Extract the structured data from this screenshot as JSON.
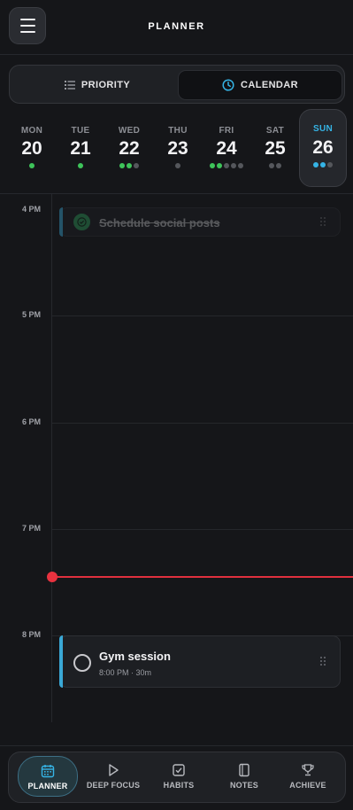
{
  "header": {
    "title": "PLANNER"
  },
  "view_toggle": {
    "priority_label": "PRIORITY",
    "calendar_label": "CALENDAR",
    "selected": "CALENDAR"
  },
  "days": [
    {
      "name": "MON",
      "num": "20",
      "dots": [
        "#3ec45a"
      ]
    },
    {
      "name": "TUE",
      "num": "21",
      "dots": [
        "#3ec45a"
      ]
    },
    {
      "name": "WED",
      "num": "22",
      "dots": [
        "#3ec45a",
        "#3ec45a",
        "#55575c"
      ]
    },
    {
      "name": "THU",
      "num": "23",
      "dots": [
        "#55575c"
      ]
    },
    {
      "name": "FRI",
      "num": "24",
      "dots": [
        "#3ec45a",
        "#3ec45a",
        "#55575c",
        "#55575c",
        "#55575c"
      ]
    },
    {
      "name": "SAT",
      "num": "25",
      "dots": [
        "#55575c",
        "#55575c"
      ]
    },
    {
      "name": "SUN",
      "num": "26",
      "dots": [
        "#35b4e6",
        "#35b4e6",
        "#55575c"
      ],
      "selected": true
    }
  ],
  "timeline": {
    "hours": [
      "4 PM",
      "5 PM",
      "6 PM",
      "7 PM",
      "8 PM"
    ],
    "events": [
      {
        "title": "Schedule social posts",
        "completed": true
      },
      {
        "title": "Gym session",
        "meta": "8:00 PM · 30m",
        "completed": false
      }
    ]
  },
  "nav": {
    "items": [
      {
        "label": "PLANNER",
        "icon": "calendar-icon",
        "active": true
      },
      {
        "label": "DEEP FOCUS",
        "icon": "play-icon"
      },
      {
        "label": "HABITS",
        "icon": "checkbox-icon"
      },
      {
        "label": "NOTES",
        "icon": "notebook-icon"
      },
      {
        "label": "ACHIEVE",
        "icon": "trophy-icon"
      }
    ]
  },
  "colors": {
    "accent": "#35b4e6",
    "now_line": "#e0303e",
    "done_green": "#3ec45a"
  }
}
